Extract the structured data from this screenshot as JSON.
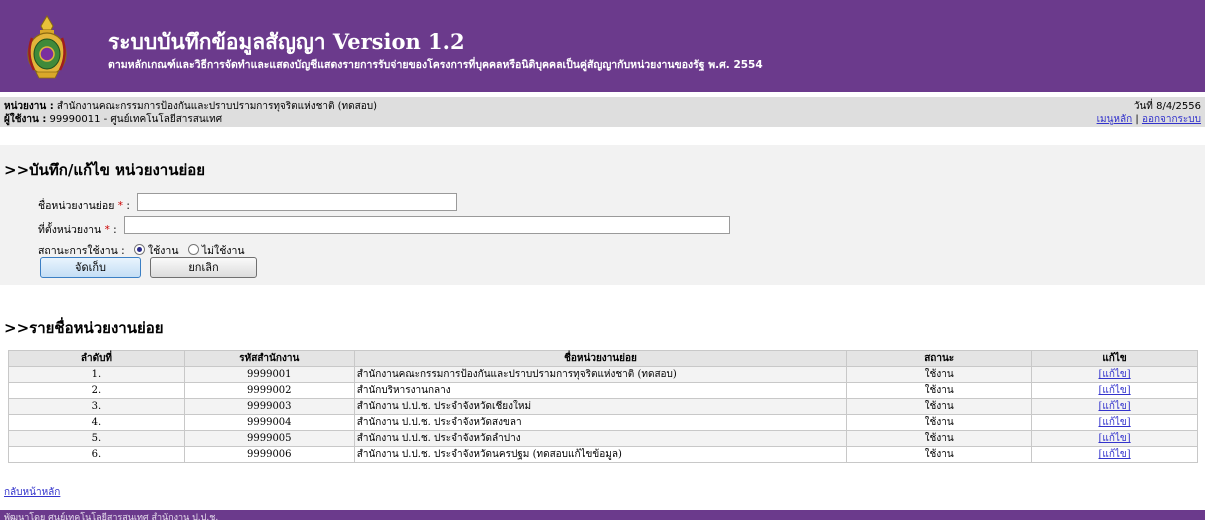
{
  "header": {
    "title": "ระบบบันทึกข้อมูลสัญญา Version 1.2",
    "subtitle": "ตามหลักเกณฑ์และวิธีการจัดทำและแสดงบัญชีแสดงรายการรับจ่ายของโครงการที่บุคคลหรือนิติบุคคลเป็นคู่สัญญากับหน่วยงานของรัฐ พ.ศ. 2554",
    "logo_icon": "government-emblem-icon"
  },
  "info": {
    "agency_label": "หน่วยงาน :",
    "agency_value": "สำนักงานคณะกรรมการป้องกันและปราบปรามการทุจริตแห่งชาติ (ทดสอบ)",
    "user_label": "ผู้ใช้งาน :",
    "user_value": "99990011 - ศูนย์เทคโนโลยีสารสนเทศ",
    "date": "วันที่ 8/4/2556",
    "main_menu_link": "เมนูหลัก",
    "separator": "|",
    "logout_link": "ออกจากระบบ"
  },
  "form": {
    "title": ">>บันทึก/แก้ไข หน่วยงานย่อย",
    "name_label": "ชื่อหน่วยงานย่อย",
    "location_label": "ที่ตั้งหน่วยงาน",
    "required_mark": "*",
    "colon": ":",
    "status_label": "สถานะการใช้งาน :",
    "status_active": "ใช้งาน",
    "status_inactive": "ไม่ใช้งาน",
    "save_button": "จัดเก็บ",
    "cancel_button": "ยกเลิก",
    "name_value": "",
    "location_value": ""
  },
  "list": {
    "title": ">>รายชื่อหน่วยงานย่อย",
    "columns": [
      "ลำดับที่",
      "รหัสสำนักงาน",
      "ชื่อหน่วยงานย่อย",
      "สถานะ",
      "แก้ไข"
    ],
    "rows": [
      {
        "no": "1.",
        "code": "9999001",
        "name": "สำนักงานคณะกรรมการป้องกันและปราบปรามการทุจริตแห่งชาติ (ทดสอบ)",
        "status": "ใช้งาน",
        "edit": "[แก้ไข]"
      },
      {
        "no": "2.",
        "code": "9999002",
        "name": "สำนักบริหารงานกลาง",
        "status": "ใช้งาน",
        "edit": "[แก้ไข]"
      },
      {
        "no": "3.",
        "code": "9999003",
        "name": "สำนักงาน ป.ป.ช. ประจำจังหวัดเชียงใหม่",
        "status": "ใช้งาน",
        "edit": "[แก้ไข]"
      },
      {
        "no": "4.",
        "code": "9999004",
        "name": "สำนักงาน ป.ป.ช. ประจำจังหวัดสงขลา",
        "status": "ใช้งาน",
        "edit": "[แก้ไข]"
      },
      {
        "no": "5.",
        "code": "9999005",
        "name": "สำนักงาน ป.ป.ช. ประจำจังหวัดลำปาง",
        "status": "ใช้งาน",
        "edit": "[แก้ไข]"
      },
      {
        "no": "6.",
        "code": "9999006",
        "name": "สำนักงาน ป.ป.ช. ประจำจังหวัดนครปฐม (ทดสอบแก้ไขข้อมูล)",
        "status": "ใช้งาน",
        "edit": "[แก้ไข]"
      }
    ]
  },
  "back_link": "กลับหน้าหลัก",
  "footer": "พัฒนาโดย ศูนย์เทคโนโลยีสารสนเทศ สำนักงาน ป.ป.ช."
}
